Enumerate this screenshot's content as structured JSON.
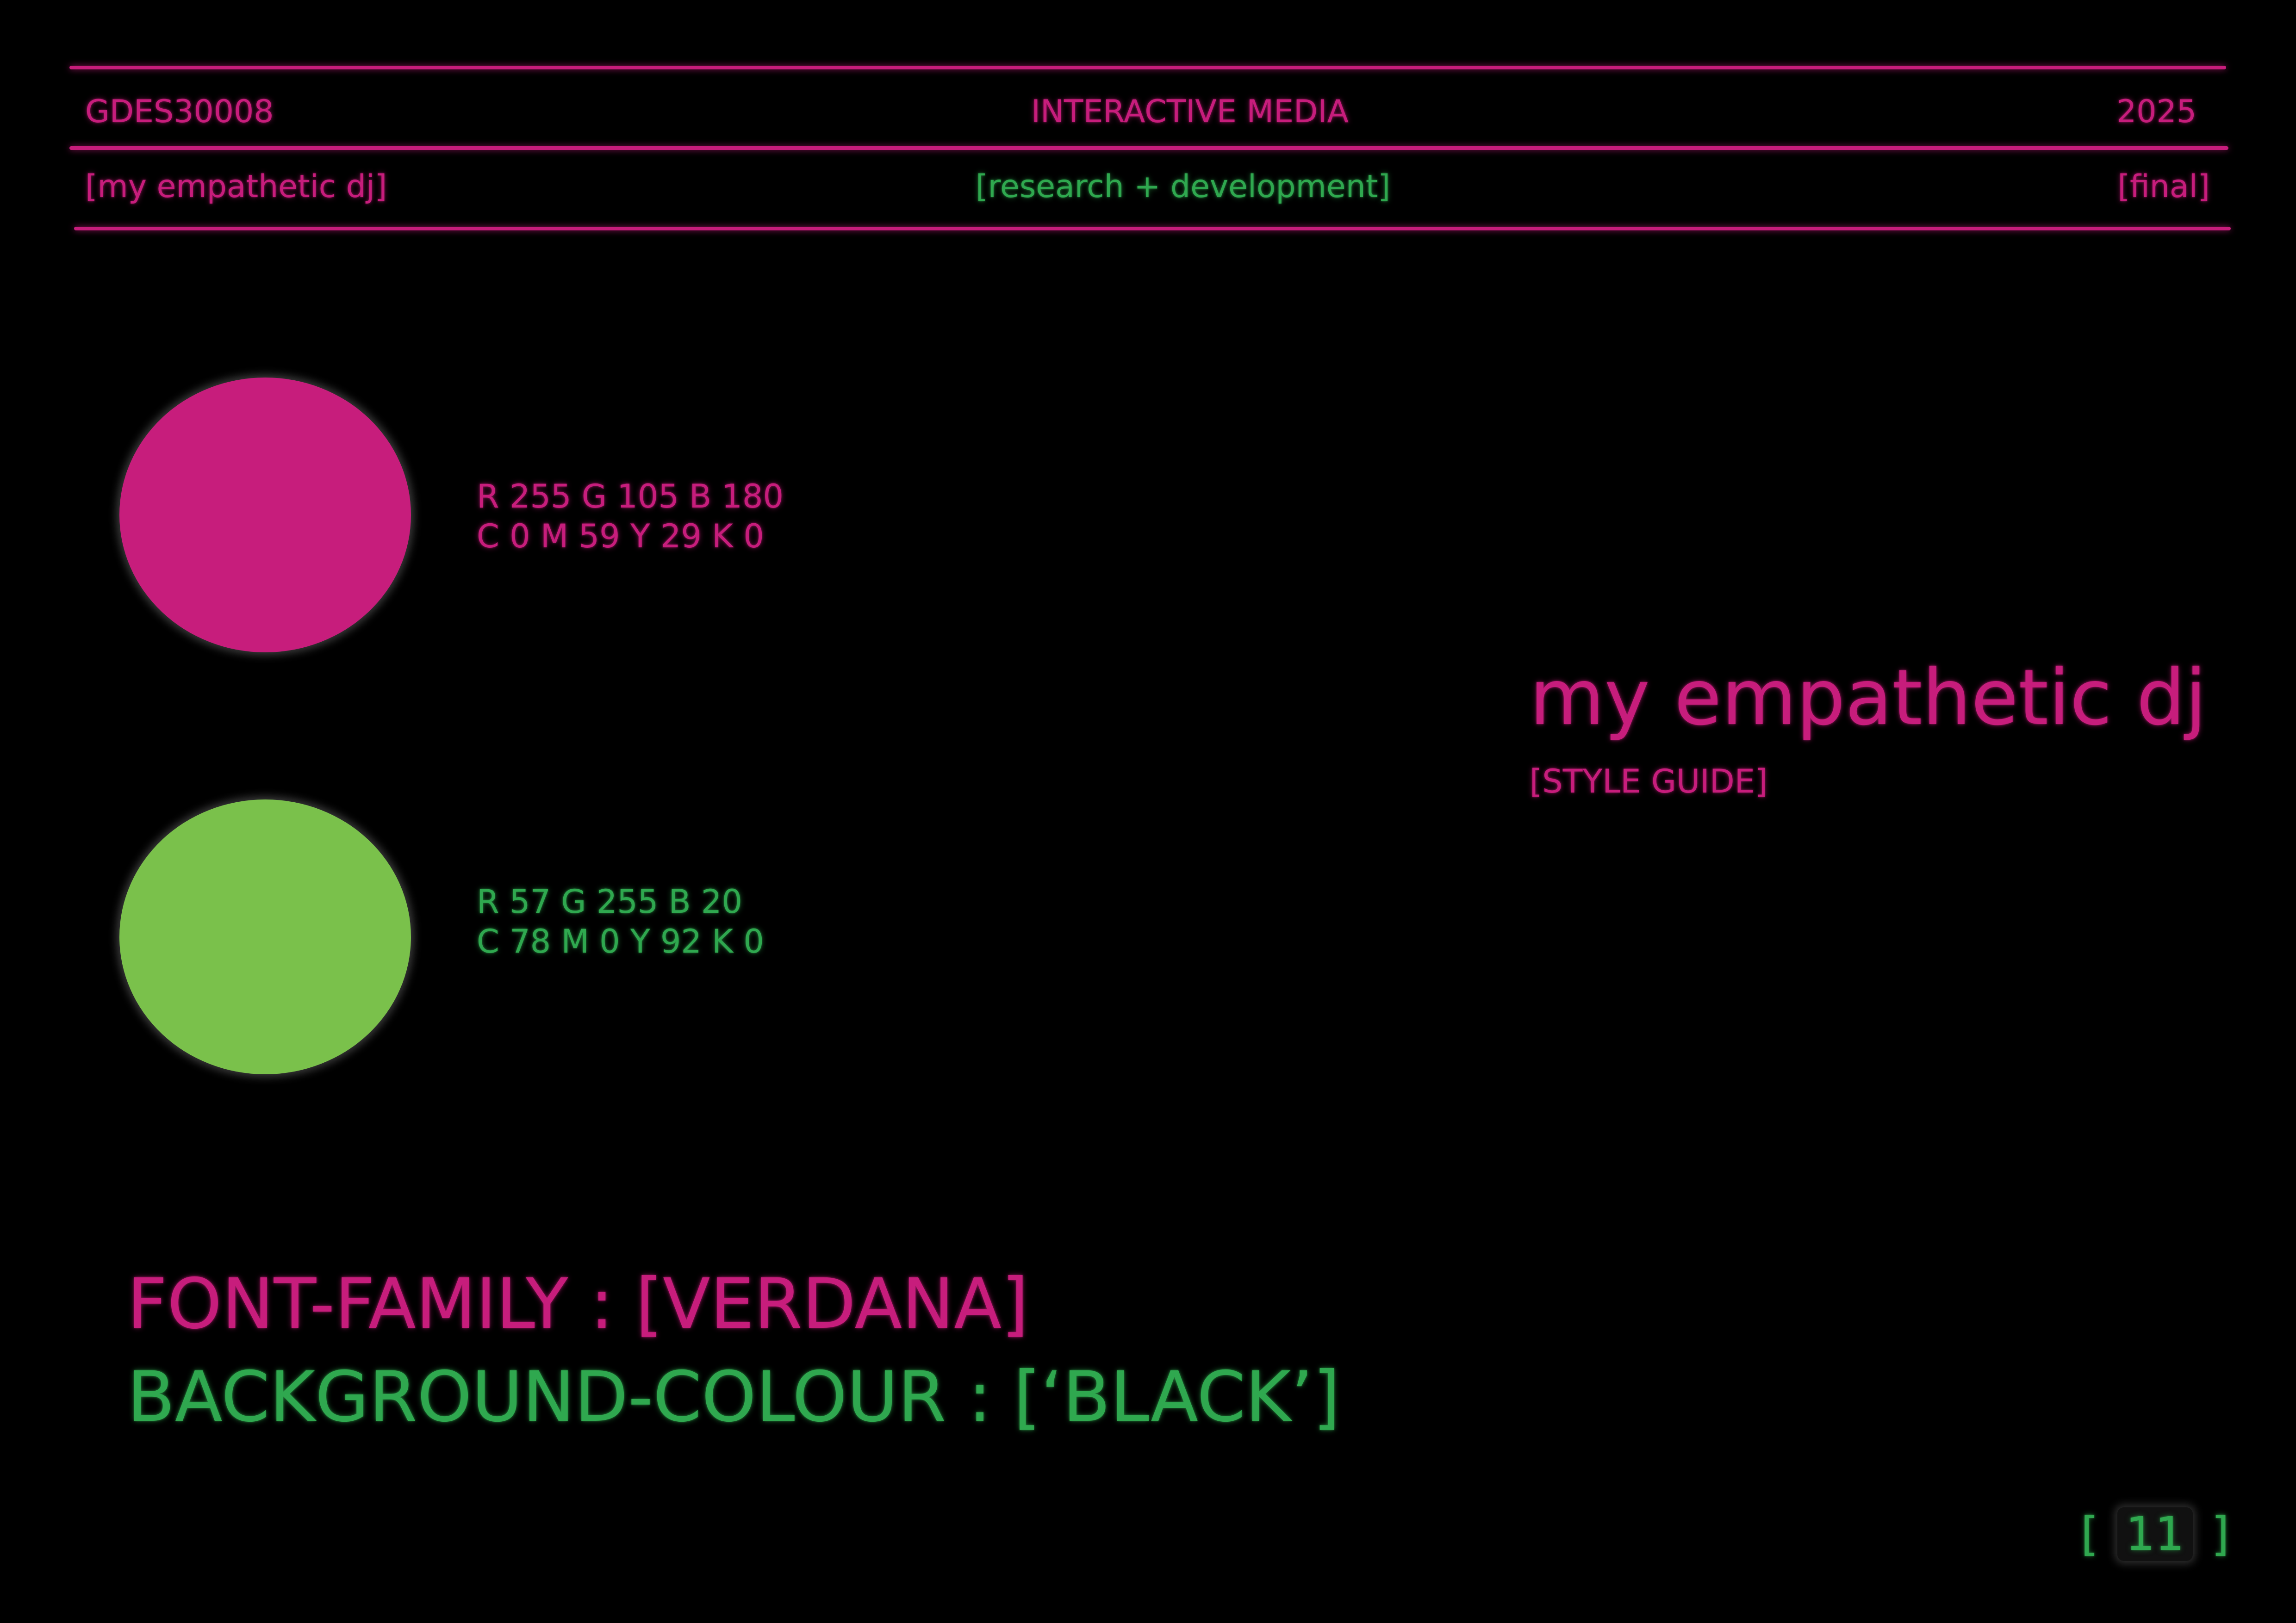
{
  "header": {
    "course_code": "GDES30008",
    "course_name": "INTERACTIVE MEDIA",
    "year": "2025",
    "project": "[my empathetic dj]",
    "phase": "[research + development]",
    "status": "[final]"
  },
  "palette": {
    "pink": {
      "hex": "#C71D7C",
      "rgb": "R 255 G 105 B 180",
      "cmyk": "C 0 M 59 Y 29 K 0"
    },
    "green": {
      "hex": "#7AC14B",
      "rgb": "R 57 G 255 B 20",
      "cmyk": "C 78 M 0 Y 92 K 0"
    }
  },
  "brand": {
    "title": "my empathetic dj",
    "subtitle": "[STYLE GUIDE]"
  },
  "properties": {
    "font_family": "FONT-FAMILY : [VERDANA]",
    "background_colour": "BACKGROUND-COLOUR : [‘BLACK’]"
  },
  "page": {
    "open_bracket": "[",
    "number": "11",
    "close_bracket": "]"
  },
  "colors": {
    "accent_pink": "#C71D7C",
    "accent_green": "#2FA84F",
    "background": "#000000"
  }
}
